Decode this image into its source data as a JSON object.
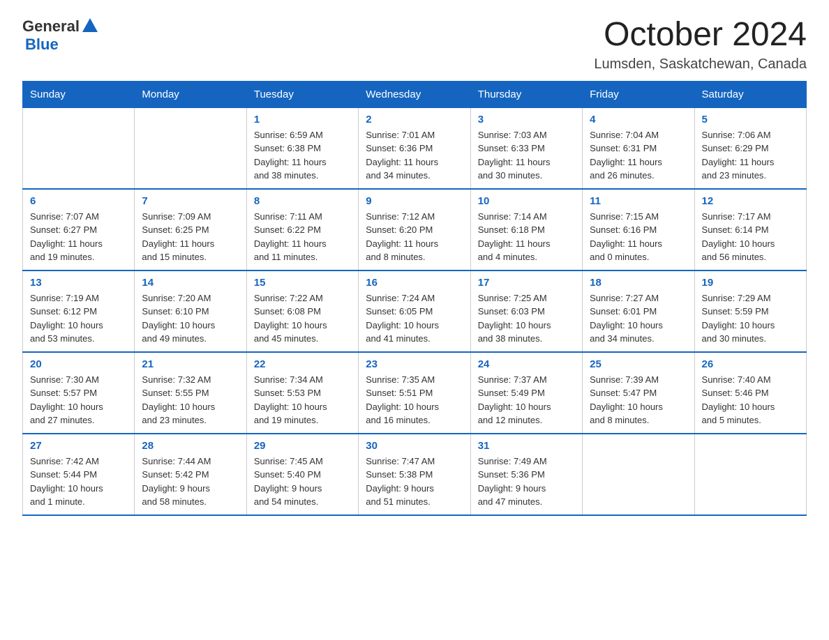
{
  "header": {
    "logo_general": "General",
    "logo_blue": "Blue",
    "month": "October 2024",
    "location": "Lumsden, Saskatchewan, Canada"
  },
  "weekdays": [
    "Sunday",
    "Monday",
    "Tuesday",
    "Wednesday",
    "Thursday",
    "Friday",
    "Saturday"
  ],
  "weeks": [
    [
      {
        "day": "",
        "info": ""
      },
      {
        "day": "",
        "info": ""
      },
      {
        "day": "1",
        "info": "Sunrise: 6:59 AM\nSunset: 6:38 PM\nDaylight: 11 hours\nand 38 minutes."
      },
      {
        "day": "2",
        "info": "Sunrise: 7:01 AM\nSunset: 6:36 PM\nDaylight: 11 hours\nand 34 minutes."
      },
      {
        "day": "3",
        "info": "Sunrise: 7:03 AM\nSunset: 6:33 PM\nDaylight: 11 hours\nand 30 minutes."
      },
      {
        "day": "4",
        "info": "Sunrise: 7:04 AM\nSunset: 6:31 PM\nDaylight: 11 hours\nand 26 minutes."
      },
      {
        "day": "5",
        "info": "Sunrise: 7:06 AM\nSunset: 6:29 PM\nDaylight: 11 hours\nand 23 minutes."
      }
    ],
    [
      {
        "day": "6",
        "info": "Sunrise: 7:07 AM\nSunset: 6:27 PM\nDaylight: 11 hours\nand 19 minutes."
      },
      {
        "day": "7",
        "info": "Sunrise: 7:09 AM\nSunset: 6:25 PM\nDaylight: 11 hours\nand 15 minutes."
      },
      {
        "day": "8",
        "info": "Sunrise: 7:11 AM\nSunset: 6:22 PM\nDaylight: 11 hours\nand 11 minutes."
      },
      {
        "day": "9",
        "info": "Sunrise: 7:12 AM\nSunset: 6:20 PM\nDaylight: 11 hours\nand 8 minutes."
      },
      {
        "day": "10",
        "info": "Sunrise: 7:14 AM\nSunset: 6:18 PM\nDaylight: 11 hours\nand 4 minutes."
      },
      {
        "day": "11",
        "info": "Sunrise: 7:15 AM\nSunset: 6:16 PM\nDaylight: 11 hours\nand 0 minutes."
      },
      {
        "day": "12",
        "info": "Sunrise: 7:17 AM\nSunset: 6:14 PM\nDaylight: 10 hours\nand 56 minutes."
      }
    ],
    [
      {
        "day": "13",
        "info": "Sunrise: 7:19 AM\nSunset: 6:12 PM\nDaylight: 10 hours\nand 53 minutes."
      },
      {
        "day": "14",
        "info": "Sunrise: 7:20 AM\nSunset: 6:10 PM\nDaylight: 10 hours\nand 49 minutes."
      },
      {
        "day": "15",
        "info": "Sunrise: 7:22 AM\nSunset: 6:08 PM\nDaylight: 10 hours\nand 45 minutes."
      },
      {
        "day": "16",
        "info": "Sunrise: 7:24 AM\nSunset: 6:05 PM\nDaylight: 10 hours\nand 41 minutes."
      },
      {
        "day": "17",
        "info": "Sunrise: 7:25 AM\nSunset: 6:03 PM\nDaylight: 10 hours\nand 38 minutes."
      },
      {
        "day": "18",
        "info": "Sunrise: 7:27 AM\nSunset: 6:01 PM\nDaylight: 10 hours\nand 34 minutes."
      },
      {
        "day": "19",
        "info": "Sunrise: 7:29 AM\nSunset: 5:59 PM\nDaylight: 10 hours\nand 30 minutes."
      }
    ],
    [
      {
        "day": "20",
        "info": "Sunrise: 7:30 AM\nSunset: 5:57 PM\nDaylight: 10 hours\nand 27 minutes."
      },
      {
        "day": "21",
        "info": "Sunrise: 7:32 AM\nSunset: 5:55 PM\nDaylight: 10 hours\nand 23 minutes."
      },
      {
        "day": "22",
        "info": "Sunrise: 7:34 AM\nSunset: 5:53 PM\nDaylight: 10 hours\nand 19 minutes."
      },
      {
        "day": "23",
        "info": "Sunrise: 7:35 AM\nSunset: 5:51 PM\nDaylight: 10 hours\nand 16 minutes."
      },
      {
        "day": "24",
        "info": "Sunrise: 7:37 AM\nSunset: 5:49 PM\nDaylight: 10 hours\nand 12 minutes."
      },
      {
        "day": "25",
        "info": "Sunrise: 7:39 AM\nSunset: 5:47 PM\nDaylight: 10 hours\nand 8 minutes."
      },
      {
        "day": "26",
        "info": "Sunrise: 7:40 AM\nSunset: 5:46 PM\nDaylight: 10 hours\nand 5 minutes."
      }
    ],
    [
      {
        "day": "27",
        "info": "Sunrise: 7:42 AM\nSunset: 5:44 PM\nDaylight: 10 hours\nand 1 minute."
      },
      {
        "day": "28",
        "info": "Sunrise: 7:44 AM\nSunset: 5:42 PM\nDaylight: 9 hours\nand 58 minutes."
      },
      {
        "day": "29",
        "info": "Sunrise: 7:45 AM\nSunset: 5:40 PM\nDaylight: 9 hours\nand 54 minutes."
      },
      {
        "day": "30",
        "info": "Sunrise: 7:47 AM\nSunset: 5:38 PM\nDaylight: 9 hours\nand 51 minutes."
      },
      {
        "day": "31",
        "info": "Sunrise: 7:49 AM\nSunset: 5:36 PM\nDaylight: 9 hours\nand 47 minutes."
      },
      {
        "day": "",
        "info": ""
      },
      {
        "day": "",
        "info": ""
      }
    ]
  ]
}
